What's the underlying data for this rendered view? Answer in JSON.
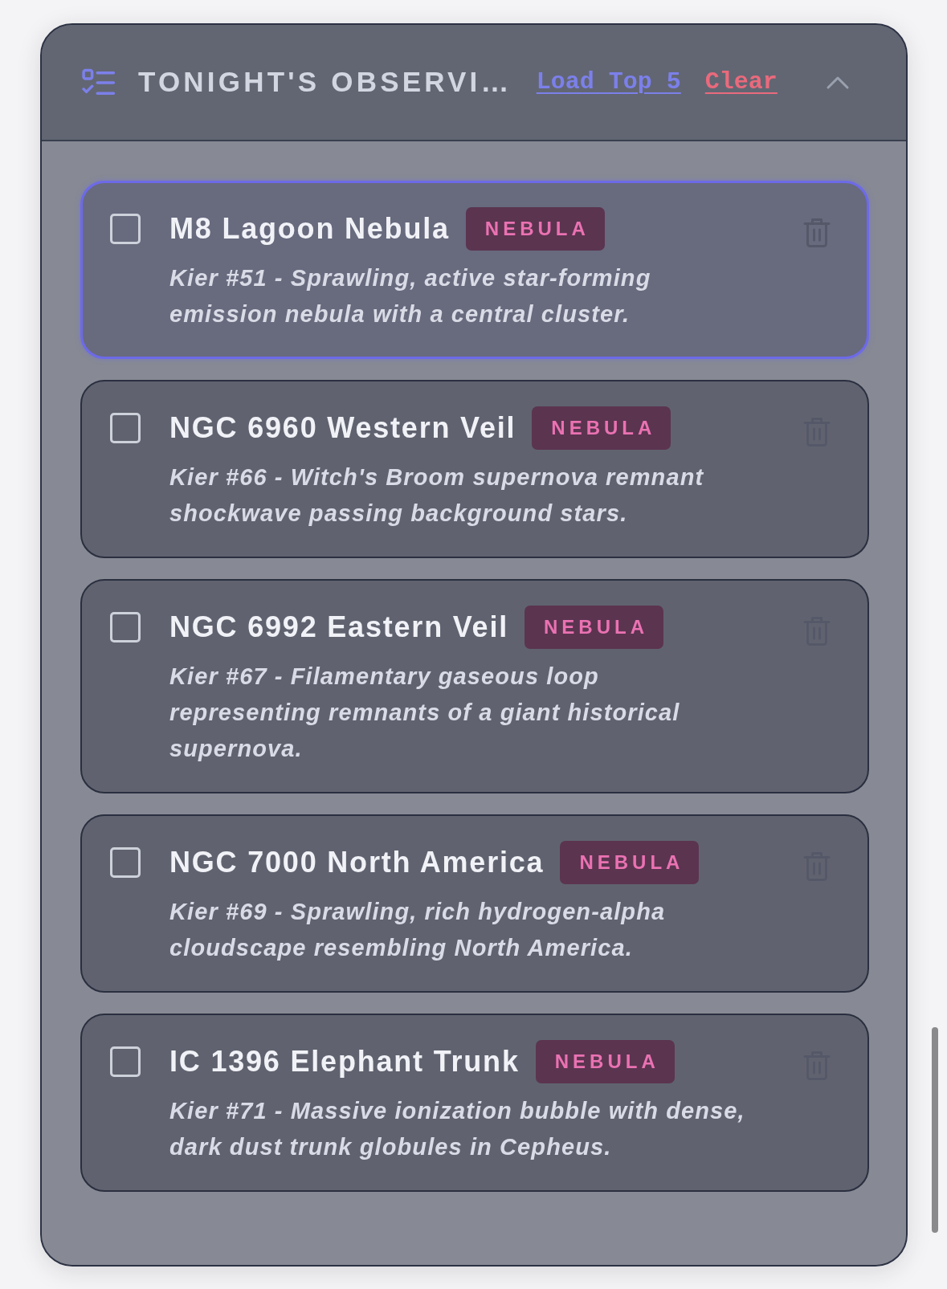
{
  "panel": {
    "title": "TONIGHT'S OBSERVI…",
    "actions": [
      {
        "label": "Load Top 5",
        "kind": "load"
      },
      {
        "label": "Clear",
        "kind": "clear"
      }
    ],
    "expanded": true
  },
  "items": [
    {
      "name": "M8 Lagoon Nebula",
      "tag": "NEBULA",
      "description": "Kier #51 - Sprawling, active star-forming emission nebula with a central cluster.",
      "checked": false,
      "selected": true
    },
    {
      "name": "NGC 6960 Western Veil",
      "tag": "NEBULA",
      "description": "Kier #66 - Witch's Broom supernova remnant shockwave passing background stars.",
      "checked": false,
      "selected": false
    },
    {
      "name": "NGC 6992 Eastern Veil",
      "tag": "NEBULA",
      "description": "Kier #67 - Filamentary gaseous loop representing remnants of a giant historical supernova.",
      "checked": false,
      "selected": false
    },
    {
      "name": "NGC 7000 North America",
      "tag": "NEBULA",
      "description": "Kier #69 - Sprawling, rich hydrogen-alpha cloudscape resembling North America.",
      "checked": false,
      "selected": false
    },
    {
      "name": "IC 1396 Elephant Trunk",
      "tag": "NEBULA",
      "description": "Kier #71 - Massive ionization bubble with dense, dark dust trunk globules in Cepheus.",
      "checked": false,
      "selected": false
    }
  ]
}
